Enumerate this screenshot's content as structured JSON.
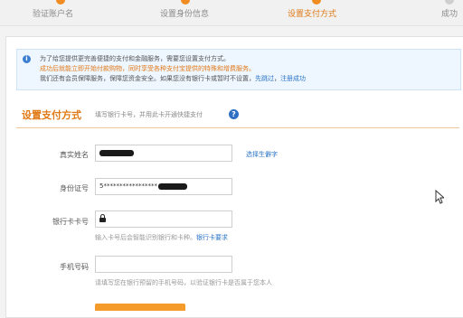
{
  "steps": [
    {
      "label": "验证账户名",
      "state": "done"
    },
    {
      "label": "设置身份信息",
      "state": "done"
    },
    {
      "label": "设置支付方式",
      "state": "active"
    },
    {
      "label": "成功",
      "state": "pending"
    }
  ],
  "notice": {
    "line1": "为了给您提供更完善便捷的支付和金融服务，需要您设置支付方式。",
    "line2": "成功后就能立即开始付款购物，同时享受各种支付宝提供的特殊和增费服务。",
    "line3_prefix": "我们还有会员保障服务，保障您资金安全。如果您没有银行卡或暂时不设置，",
    "skip_link": "先跳过",
    "line3_sep": "，",
    "register_link": "注册成功"
  },
  "section": {
    "title": "设置支付方式",
    "hint": "填写银行卡号，并用此卡开通快捷支付"
  },
  "form": {
    "name_label": "真实姓名",
    "rare_char_link": "选择生僻字",
    "id_label": "身份证号",
    "id_value": "5*****************",
    "card_label": "银行卡卡号",
    "card_hint": "输入卡号后会智能识别银行和卡种。",
    "card_req_link": "银行卡要求",
    "phone_label": "手机号码",
    "phone_hint": "请填写您在银行预留的手机号码，以验证银行卡是否属于您本人"
  }
}
